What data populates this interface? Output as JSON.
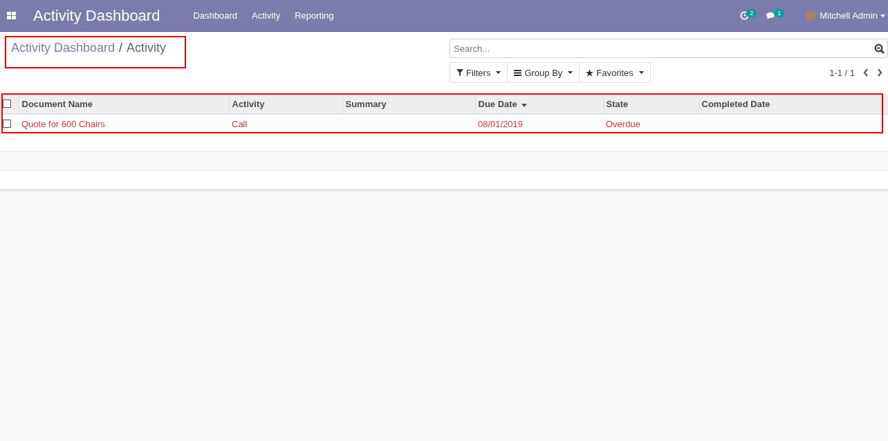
{
  "navbar": {
    "app_title": "Activity Dashboard",
    "menu": [
      "Dashboard",
      "Activity",
      "Reporting"
    ],
    "activity_count": "2",
    "message_count": "1",
    "user": "Mitchell Admin"
  },
  "breadcrumb": [
    "Activity Dashboard",
    "Activity"
  ],
  "breadcrumb_separator": "/",
  "search": {
    "placeholder": "Search..."
  },
  "filters": [
    {
      "kind": "filter",
      "label": "Filters"
    },
    {
      "kind": "group",
      "label": "Group By"
    },
    {
      "kind": "favorite",
      "label": "Favorites"
    }
  ],
  "pager": "1-1 / 1",
  "table": {
    "all_checked": false,
    "columns": [
      {
        "label": "Document Name",
        "sorted": false
      },
      {
        "label": "Activity",
        "sorted": false
      },
      {
        "label": "Summary",
        "sorted": false
      },
      {
        "label": "Due Date",
        "sorted": true
      },
      {
        "label": "State",
        "sorted": false
      },
      {
        "label": "Completed Date",
        "sorted": false
      }
    ],
    "rows": [
      {
        "checked": false,
        "overdue": true,
        "cells": [
          "Quote for 600 Chairs",
          "Call",
          "",
          "08/01/2019",
          "Overdue",
          ""
        ]
      }
    ]
  }
}
